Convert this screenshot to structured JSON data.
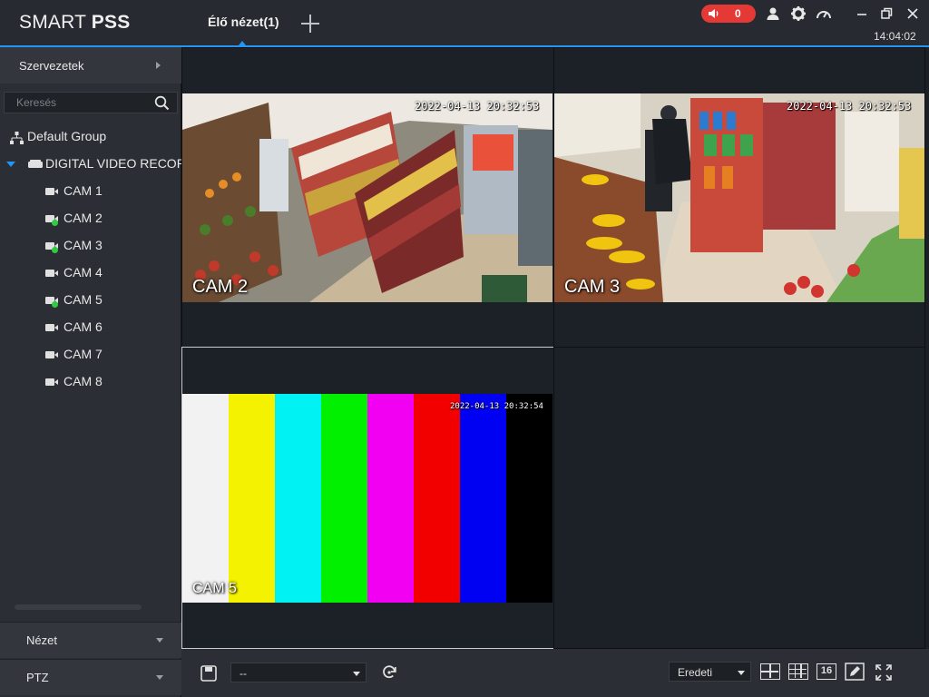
{
  "app": {
    "brand_light": "SMART ",
    "brand_bold": "PSS",
    "clock": "14:04:02"
  },
  "tabs": [
    {
      "label": "Élő nézet(1)"
    }
  ],
  "alarm": {
    "count": "0"
  },
  "sidebar": {
    "org_label": "Szervezetek",
    "search_placeholder": "Keresés",
    "tree": {
      "group": "Default Group",
      "device": "DIGITAL VIDEO RECORDER",
      "cameras": [
        {
          "label": "CAM 1",
          "online": false
        },
        {
          "label": "CAM 2",
          "online": true
        },
        {
          "label": "CAM 3",
          "online": true
        },
        {
          "label": "CAM 4",
          "online": false
        },
        {
          "label": "CAM 5",
          "online": true
        },
        {
          "label": "CAM 6",
          "online": false
        },
        {
          "label": "CAM 7",
          "online": false
        },
        {
          "label": "CAM 8",
          "online": false
        }
      ]
    },
    "panels": [
      {
        "label": "Nézet"
      },
      {
        "label": "PTZ"
      }
    ]
  },
  "views": [
    {
      "name": "CAM 2",
      "timestamp": "2022-04-13 20:32:53"
    },
    {
      "name": "CAM 3",
      "timestamp": "2022-04-13 20:32:53"
    },
    {
      "name": "CAM 5",
      "timestamp": "2022-04-13 20:32:54"
    }
  ],
  "toolbar": {
    "view_select": "--",
    "stream_select": "Eredeti",
    "layout_16": "16"
  }
}
